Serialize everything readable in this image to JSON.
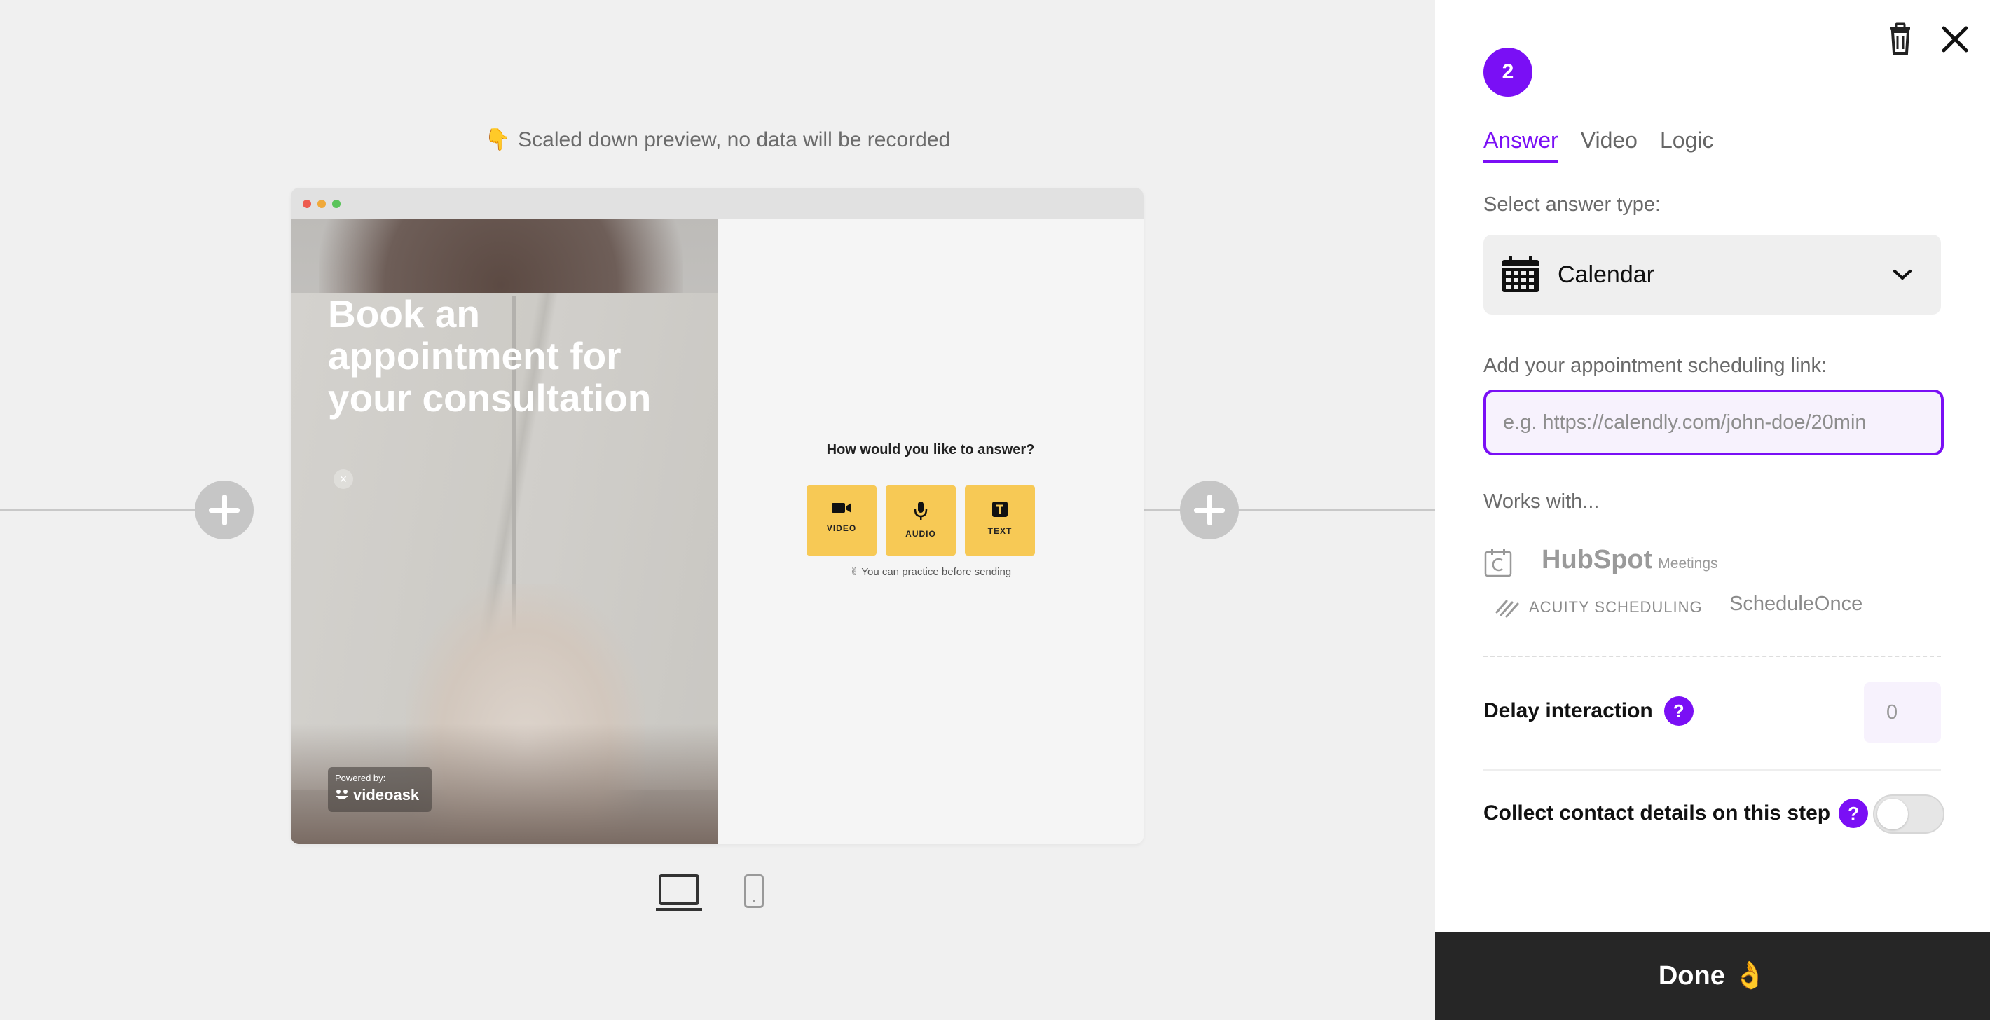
{
  "preview": {
    "note_icon": "👇",
    "note": "Scaled down preview, no data will be recorded"
  },
  "video": {
    "title": "Book an appointment for your consultation",
    "close": "×",
    "powered_by": "Powered by:",
    "brand": "videoask"
  },
  "answer_area": {
    "question": "How would you like to answer?",
    "buttons": [
      "VIDEO",
      "AUDIO",
      "TEXT"
    ],
    "practice_icon": "✌",
    "practice": "You can practice before sending"
  },
  "panel": {
    "step": "2",
    "tabs": [
      "Answer",
      "Video",
      "Logic"
    ],
    "answer_type_label": "Select answer type:",
    "answer_type_value": "Calendar",
    "link_label": "Add your appointment scheduling link:",
    "link_placeholder": "e.g. https://calendly.com/john-doe/20min",
    "link_value": "",
    "works_with": "Works with...",
    "integrations": {
      "hubspot": "HubSpot",
      "hubspot_sub": "Meetings",
      "acuity": "ACUITY SCHEDULING",
      "scheduleonce": "ScheduleOnce"
    },
    "delay_label": "Delay interaction",
    "delay_value": "0",
    "contact_label": "Collect contact details on this step",
    "contact_enabled": false,
    "help": "?",
    "done": "Done",
    "done_emoji": "👌"
  },
  "colors": {
    "accent": "#7a0ff5",
    "answer_button": "#f7c955",
    "done_bg": "#262626"
  }
}
